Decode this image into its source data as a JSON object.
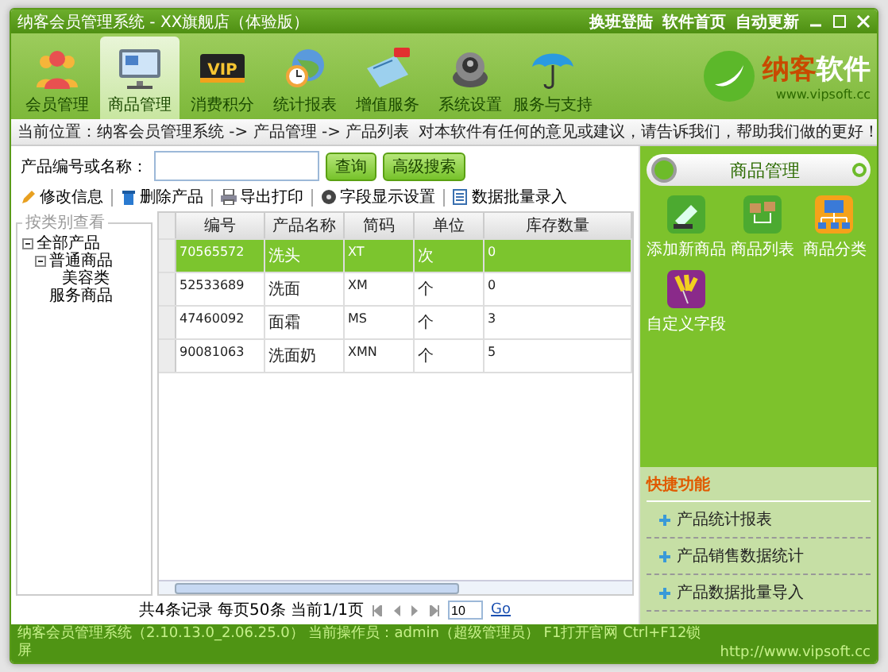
{
  "window": {
    "title": "纳客会员管理系统 - XX旗舰店（体验版）",
    "links": [
      "换班登陆",
      "软件首页",
      "自动更新"
    ]
  },
  "nav": [
    {
      "label": "会员管理",
      "kind": "people",
      "selected": false
    },
    {
      "label": "商品管理",
      "kind": "monitor",
      "selected": true
    },
    {
      "label": "消费积分",
      "kind": "vip",
      "badge": "VIP",
      "selected": false
    },
    {
      "label": "统计报表",
      "kind": "clock",
      "selected": false
    },
    {
      "label": "增值服务",
      "kind": "card",
      "selected": false
    },
    {
      "label": "系统设置",
      "kind": "gear",
      "selected": false
    },
    {
      "label": "服务与支持",
      "kind": "umbrella",
      "selected": false
    }
  ],
  "logo": {
    "name_a": "纳客",
    "name_b": "软件",
    "url": "www.vipsoft.cc"
  },
  "breadcrumb": "当前位置：纳客会员管理系统 -> 产品管理 -> 产品列表",
  "feedback": "对本软件有任何的意见或建议，请告诉我们，帮助我们做的更好！",
  "search": {
    "label": "产品编号或名称：",
    "buttons": [
      "查询",
      "高级搜索"
    ]
  },
  "toolbar": [
    {
      "label": "修改信息",
      "kind": "pencil"
    },
    {
      "label": "删除产品",
      "kind": "trash"
    },
    {
      "label": "导出打印",
      "kind": "printer"
    },
    {
      "label": "字段显示设置",
      "kind": "disc"
    },
    {
      "label": "数据批量录入",
      "kind": "sheet"
    }
  ],
  "tree": {
    "legend": "按类别查看",
    "items": [
      {
        "label": "全部产品",
        "expanded": true,
        "children": [
          {
            "label": "普通商品",
            "expanded": true,
            "children": [
              {
                "label": "美容类"
              }
            ]
          },
          {
            "label": "服务商品"
          }
        ]
      }
    ]
  },
  "table": {
    "columns": [
      "编号",
      "产品名称",
      "简码",
      "单位",
      "库存数量"
    ],
    "rows": [
      {
        "cells": [
          "70565572",
          "洗头",
          "XT",
          "次",
          "0"
        ],
        "selected": true
      },
      {
        "cells": [
          "52533689",
          "洗面",
          "XM",
          "个",
          "0"
        ],
        "selected": false
      },
      {
        "cells": [
          "47460092",
          "面霜",
          "MS",
          "个",
          "3"
        ],
        "selected": false
      },
      {
        "cells": [
          "90081063",
          "洗面奶",
          "XMN",
          "个",
          "5"
        ],
        "selected": false
      }
    ]
  },
  "pager": {
    "summary": "共4条记录 每页50条 当前1/1页",
    "page_input": "10",
    "go": "Go"
  },
  "panel": {
    "title": "商品管理",
    "items": [
      {
        "label": "添加新商品",
        "kind": "scanner"
      },
      {
        "label": "商品列表",
        "kind": "boxes"
      },
      {
        "label": "商品分类",
        "kind": "network"
      },
      {
        "label": "自定义字段",
        "kind": "pins"
      }
    ]
  },
  "shortcuts": {
    "title": "快捷功能",
    "items": [
      "产品统计报表",
      "产品销售数据统计",
      "产品数据批量导入"
    ]
  },
  "status_bar": {
    "text": "纳客会员管理系统（2.10.13.0_2.06.25.0） 当前操作员：admin（超级管理员） F1打开官网 Ctrl+F12锁屏",
    "url": "http://www.vipsoft.cc"
  }
}
